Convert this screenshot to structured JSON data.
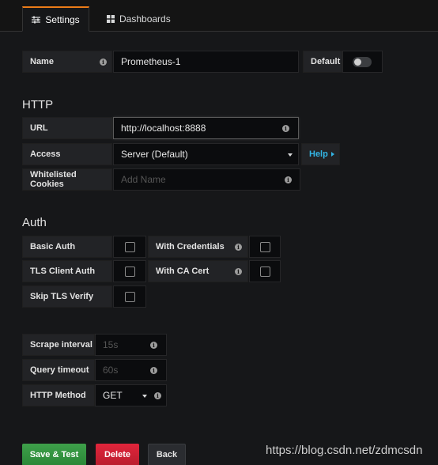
{
  "tabs": [
    {
      "label": "Settings",
      "icon": "sliders-icon",
      "active": true
    },
    {
      "label": "Dashboards",
      "icon": "grid-icon",
      "active": false
    }
  ],
  "name": {
    "label": "Name",
    "value": "Prometheus-1"
  },
  "default": {
    "label": "Default",
    "enabled": false
  },
  "http": {
    "title": "HTTP",
    "url": {
      "label": "URL",
      "value": "http://localhost:8888"
    },
    "access": {
      "label": "Access",
      "value": "Server (Default)",
      "help_label": "Help"
    },
    "whitelisted_cookies": {
      "label": "Whitelisted Cookies",
      "placeholder": "Add Name"
    }
  },
  "auth": {
    "title": "Auth",
    "basic_auth": {
      "label": "Basic Auth",
      "checked": false
    },
    "with_credentials": {
      "label": "With Credentials",
      "checked": false
    },
    "tls_client_auth": {
      "label": "TLS Client Auth",
      "checked": false
    },
    "with_ca_cert": {
      "label": "With CA Cert",
      "checked": false
    },
    "skip_tls_verify": {
      "label": "Skip TLS Verify",
      "checked": false
    }
  },
  "prometheus": {
    "scrape_interval": {
      "label": "Scrape interval",
      "placeholder": "15s"
    },
    "query_timeout": {
      "label": "Query timeout",
      "placeholder": "60s"
    },
    "http_method": {
      "label": "HTTP Method",
      "value": "GET"
    }
  },
  "actions": {
    "save": "Save & Test",
    "delete": "Delete",
    "back": "Back"
  },
  "watermark": "https://blog.csdn.net/zdmcsdn",
  "colors": {
    "accent_tab": "#eb7b18",
    "save": "#3ea04a",
    "delete": "#e1253b",
    "help_link": "#33b5e5"
  }
}
